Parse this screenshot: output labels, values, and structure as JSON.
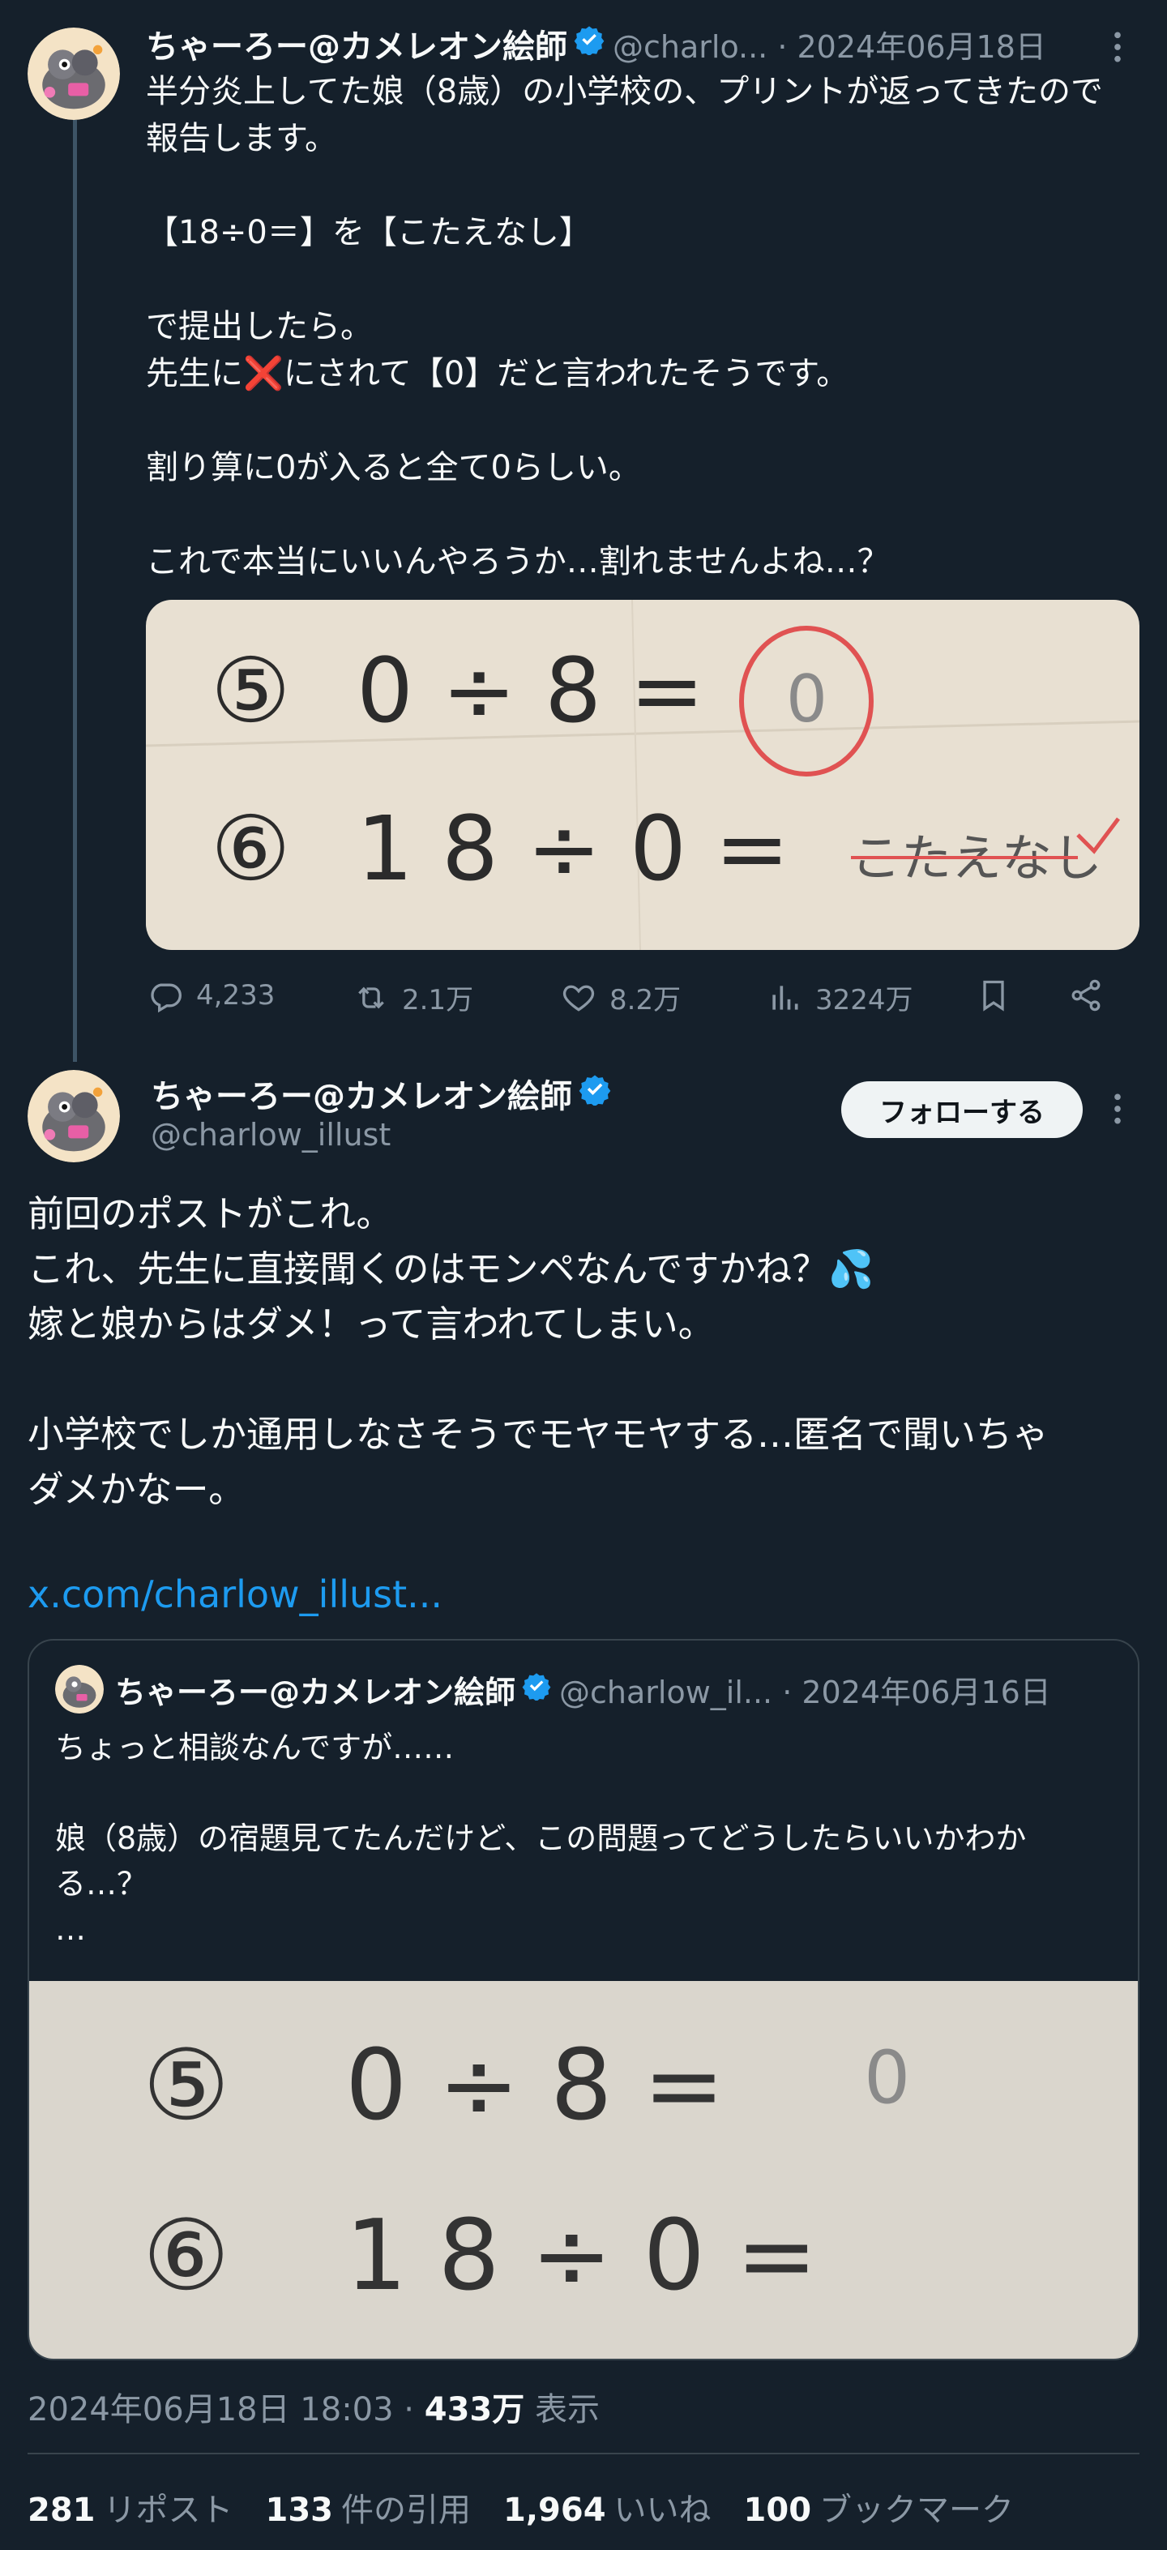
{
  "tweet1": {
    "display_name": "ちゃーろー@カメレオン絵師",
    "handle_date": "@charlo... · 2024年06月18日",
    "text": "半分炎上してた娘（8歳）の小学校の、プリントが返ってきたので\n報告します。\n\n【18÷0＝】を【こたえなし】\n\nで提出したら。\n先生に❌にされて【0】だと言われたそうです。\n\n割り算に0が入ると全て0らしい。\n\nこれで本当にいいんやろうか…割れませんよね…？",
    "image": {
      "row1": {
        "num": "⑤",
        "expr": "0 ÷ 8 =",
        "answer": "0"
      },
      "row2": {
        "num": "⑥",
        "expr": "1 8 ÷ 0 =",
        "answer": "こたえなし"
      }
    },
    "actions": {
      "reply": "4,233",
      "retweet": "2.1万",
      "like": "8.2万",
      "views": "3224万"
    }
  },
  "tweet2": {
    "display_name": "ちゃーろー@カメレオン絵師",
    "handle": "@charlow_illust",
    "follow_label": "フォローする",
    "text": "前回のポストがこれ。\nこれ、先生に直接聞くのはモンペなんですかね？💦\n嫁と娘からはダメ！って言われてしまい。\n\n小学校でしか通用しなさそうでモヤモヤする…匿名で聞いちゃ\nダメかなー。",
    "link": "x.com/charlow_illust...",
    "quote": {
      "display_name": "ちゃーろー@カメレオン絵師",
      "handle_date": "@charlow_il... · 2024年06月16日",
      "text": "ちょっと相談なんですが……\n\n娘（8歳）の宿題見てたんだけど、この問題ってどうしたらいいかわか\nる…？\n…",
      "image": {
        "row1": {
          "num": "⑤",
          "expr": "0 ÷ 8 =",
          "answer": "0"
        },
        "row2": {
          "num": "⑥",
          "expr": "1 8 ÷ 0 ="
        }
      }
    },
    "timestamp": "2024年06月18日 18:03 · ",
    "views_count": "433万",
    "views_label": " 表示",
    "stats": {
      "reposts_count": "281",
      "reposts_label": "リポスト",
      "quotes_count": "133",
      "quotes_label": "件の引用",
      "likes_count": "1,964",
      "likes_label": "いいね",
      "bookmarks_count": "100",
      "bookmarks_label": "ブックマーク"
    }
  },
  "colors": {
    "background": "#15202b",
    "text": "#f7f9f9",
    "muted": "#8b98a5",
    "accent": "#1d9bf0",
    "border": "#38444d"
  }
}
